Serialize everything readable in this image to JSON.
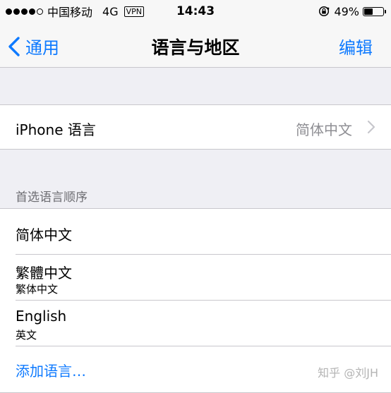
{
  "status_bar": {
    "carrier": "中国移动",
    "network": "4G",
    "vpn": "VPN",
    "time": "14:43",
    "battery_percent_text": "49%",
    "battery_level": 0.49,
    "signal_bars_filled": 4,
    "signal_bars_total": 5
  },
  "nav": {
    "back_label": "通用",
    "title": "语言与地区",
    "edit_label": "编辑"
  },
  "iphone_language": {
    "label": "iPhone 语言",
    "value": "简体中文"
  },
  "preferred": {
    "header": "首选语言顺序",
    "languages": [
      {
        "name": "简体中文",
        "subtitle": ""
      },
      {
        "name": "繁體中文",
        "subtitle": "繁体中文"
      },
      {
        "name": "English",
        "subtitle": "英文"
      }
    ],
    "add_label": "添加语言…"
  },
  "watermark": "知乎 @刘JH",
  "colors": {
    "accent": "#0e7aff",
    "background": "#efeff4",
    "separator": "#c8c7cc",
    "secondary_text": "#8e8e93"
  }
}
